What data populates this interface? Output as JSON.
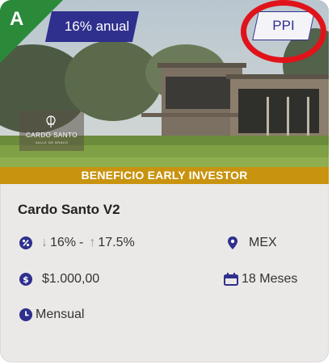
{
  "card": {
    "rating_letter": "A",
    "rate_badge": "16% anual",
    "type_tag": "PPI",
    "logo_name": "CARDO SANTO",
    "logo_sub": "VALLE DE BRAVO",
    "benefit_banner": "BENEFICIO EARLY INVESTOR",
    "title": "Cardo Santo V2",
    "rate_min": "16%",
    "rate_separator": "-",
    "rate_max": "17.5%",
    "country": "MEX",
    "amount": "$1.000,00",
    "term": "18 Meses",
    "payment_frequency": "Mensual"
  },
  "colors": {
    "rating_green": "#2a8a3a",
    "badge_navy": "#2f2f8e",
    "banner_gold": "#c8930f",
    "highlight_red": "#e0131a",
    "icon_blue": "#2f2f8e"
  },
  "icons": [
    "percent-badge-icon",
    "arrow-down-icon",
    "arrow-up-icon",
    "location-pin-icon",
    "dollar-coin-icon",
    "calendar-icon",
    "clock-icon"
  ]
}
